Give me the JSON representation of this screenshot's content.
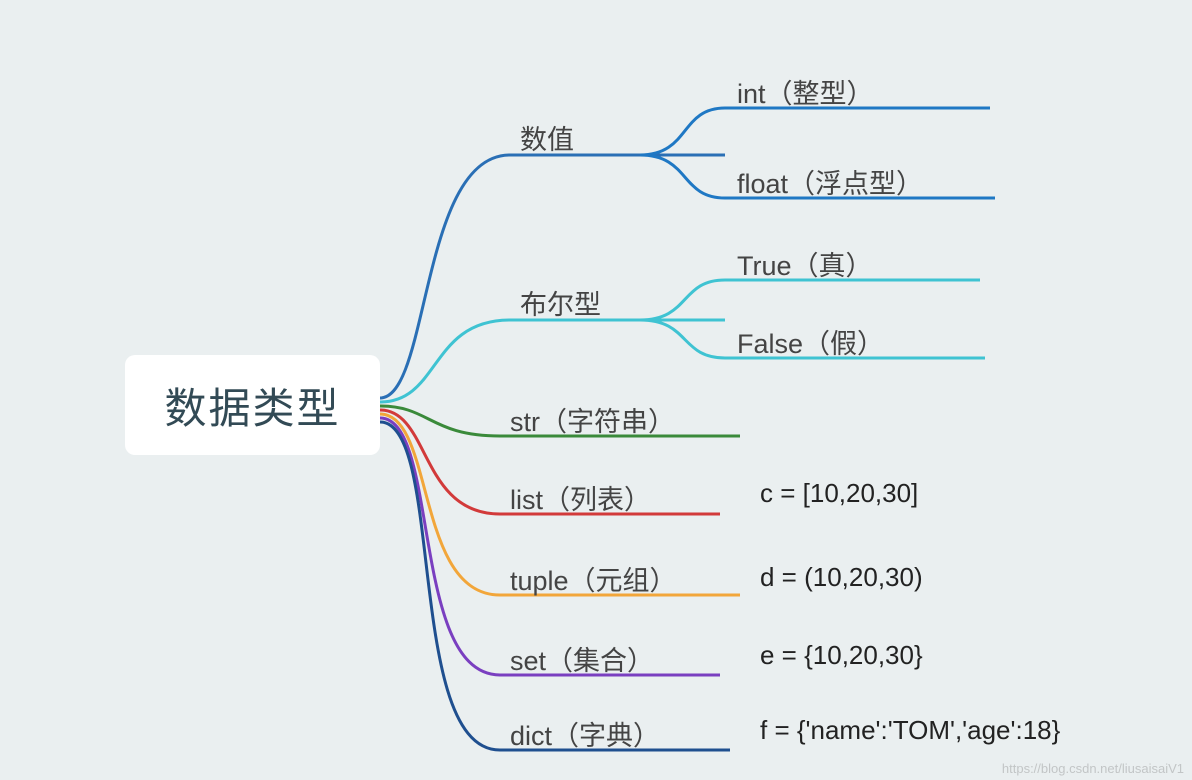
{
  "root": {
    "label": "数据类型"
  },
  "branches": {
    "numeric": {
      "label": "数值",
      "children": {
        "int": {
          "label": "int（整型）"
        },
        "float": {
          "label": "float（浮点型）"
        }
      }
    },
    "boolean": {
      "label": "布尔型",
      "children": {
        "true": {
          "label": "True（真）"
        },
        "false": {
          "label": "False（假）"
        }
      }
    },
    "str": {
      "label": "str（字符串）"
    },
    "list": {
      "label": "list（列表）",
      "example": "c = [10,20,30]"
    },
    "tuple": {
      "label": "tuple（元组）",
      "example": "d = (10,20,30)"
    },
    "set": {
      "label": "set（集合）",
      "example": "e = {10,20,30}"
    },
    "dict": {
      "label": "dict（字典）",
      "example": "f =  {'name':'TOM','age':18}"
    }
  },
  "colors": {
    "blue1": "#2a6fb5",
    "blue2": "#1f78c4",
    "cyan": "#3fc3d2",
    "green": "#3a8a3a",
    "red": "#d23a3a",
    "orange": "#f2a63a",
    "purple": "#7a3fc0",
    "navy": "#1f4f8f"
  },
  "watermark": "https://blog.csdn.net/liusaisaiV1"
}
